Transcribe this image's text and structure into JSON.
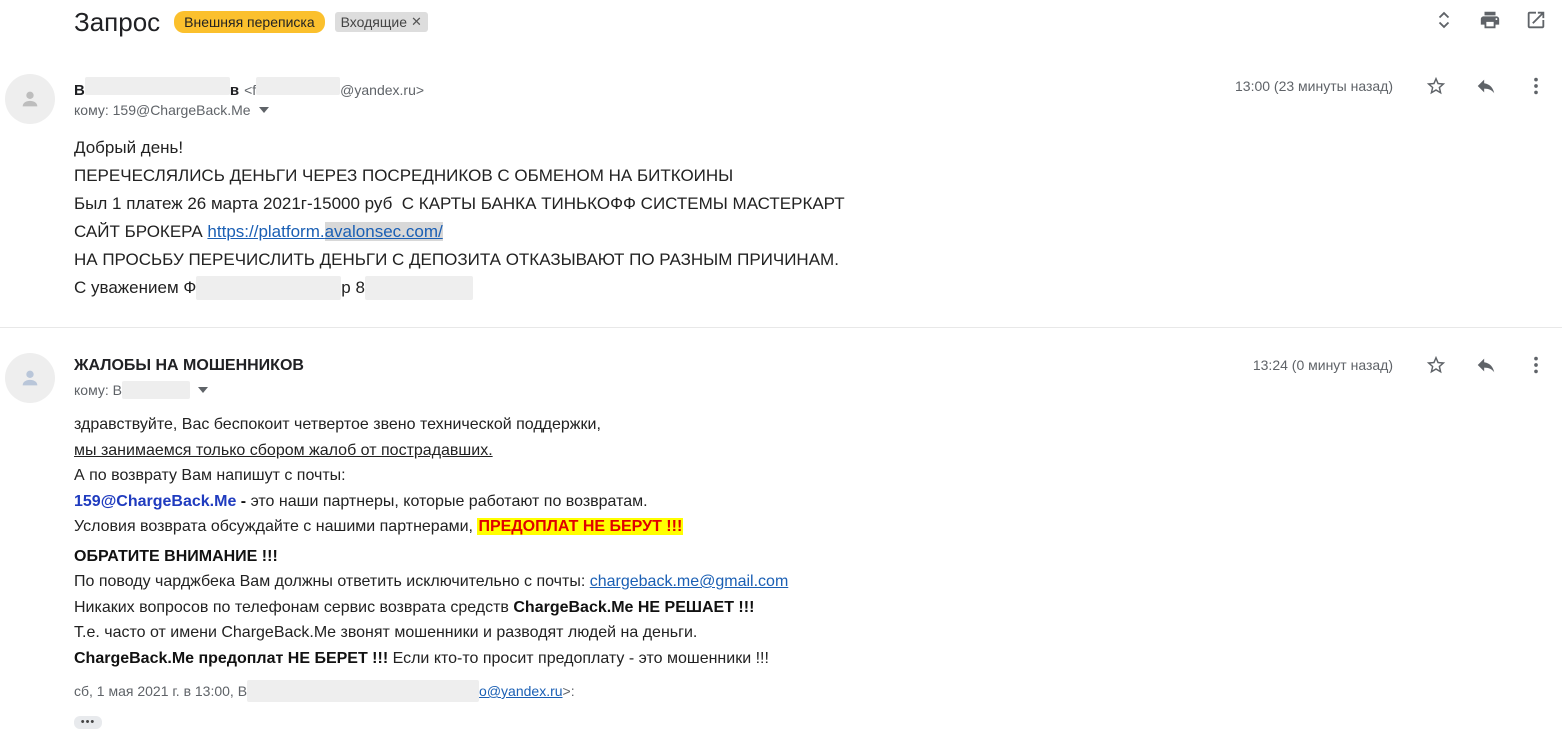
{
  "subject": "Запрос",
  "labels": [
    {
      "text": "Внешняя переписка",
      "color": "#fbc02d"
    },
    {
      "text": "Входящие",
      "removable": true
    }
  ],
  "toolbar_icons": [
    "expand-collapse-icon",
    "print-icon",
    "open-in-new-window-icon"
  ],
  "message1": {
    "sender_start": "В",
    "sender_end": "в",
    "email_start": "<f",
    "email_end": "@yandex.ru>",
    "to": "кому: 159@ChargeBack.Me",
    "time": "13:00 (23 минуты назад)",
    "body": {
      "greeting": "Добрый день!",
      "line1": "ПЕРЕЧЕСЛЯЛИСЬ ДЕНЬГИ ЧЕРЕЗ ПОСРЕДНИКОВ С ОБМЕНОМ НА БИТКОИНЫ",
      "line2": "Был 1 платеж 26 марта 2021г-15000 руб  С КАРТЫ БАНКА ТИНЬКОФФ СИСТЕМЫ МАСТЕРКАРТ",
      "line3_prefix": "САЙТ БРОКЕРА ",
      "link_part1": "https://platform.",
      "link_part2": "avalonsec.com/",
      "line4": "НА ПРОСЬБУ ПЕРЕЧИСЛИТЬ ДЕНЬГИ С ДЕПОЗИТА ОТКАЗЫВАЮТ ПО РАЗНЫМ ПРИЧИНАМ.",
      "sign_prefix": "С уважением Ф",
      "sign_mid": "р 8"
    }
  },
  "message2": {
    "sender": "ЖАЛОБЫ НА МОШЕННИКОВ",
    "to": "кому: В",
    "time": "13:24 (0 минут назад)",
    "body": {
      "l1": "здравствуйте, Вас беспокоит четвертое звено технической поддержки,",
      "l2": "мы занимаемся только сбором жалоб от пострадавших.",
      "l3": "А по возврату Вам напишут с почты:",
      "l4_email": "159@ChargeBack.Me",
      "l4_dash": " - ",
      "l4_rest": "это наши партнеры, которые работают по возвратам.",
      "l5_prefix": "Условия возврата обсуждайте с нашими партнерами, ",
      "l5_warn": "ПРЕДОПЛАТ НЕ БЕРУТ !!!",
      "l6": "ОБРАТИТЕ ВНИМАНИЕ !!!",
      "l7_prefix": "По поводу чарджбека Вам должны ответить исключительно с почты: ",
      "l7_link": "chargeback.me@gmail.com",
      "l8_prefix": "Никаких вопросов по телефонам сервис возврата средств ",
      "l8_bold": "ChargeBack.Me НЕ РЕШАЕТ !!!",
      "l9": "Т.е. часто от имени ChargeBack.Me звонят мошенники и разводят людей на деньги.",
      "l10_bold": "ChargeBack.Me предоплат НЕ БЕРЕТ !!!",
      "l10_rest": " Если кто-то просит предоплату - это мошенники !!!"
    },
    "quote_prefix": "сб, 1 мая 2021 г. в 13:00, В",
    "quote_email": "o@yandex.ru",
    "quote_suffix": ">:",
    "show_trimmed": "•••"
  }
}
